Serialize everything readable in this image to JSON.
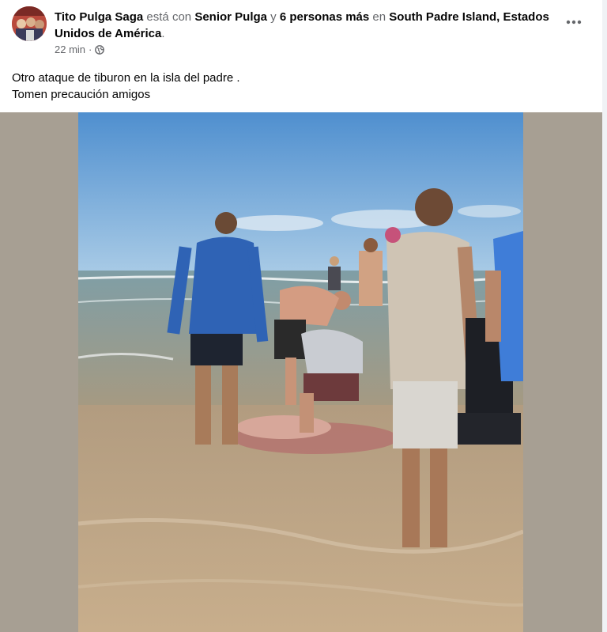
{
  "post": {
    "author": "Tito Pulga Saga",
    "with_word": "está con",
    "tagged_person": "Senior Pulga",
    "connector": "y",
    "others": "6 personas más",
    "location_word": "en",
    "location": "South Padre Island, Estados Unidos de América",
    "location_period": ".",
    "timestamp": "22 min",
    "separator": "·",
    "privacy_icon": "globe-icon",
    "more_icon": "more-options-icon",
    "caption_line_1": "Otro ataque de tiburon en la isla del padre .",
    "caption_line_2": "Tomen precaución amigos"
  },
  "photo": {
    "description_icon": "beach-photo",
    "colors": {
      "sky": "#5b9ad3",
      "sea": "#8ca6a8",
      "sand": "#b79e80",
      "side_panel": "#a79f93"
    }
  }
}
